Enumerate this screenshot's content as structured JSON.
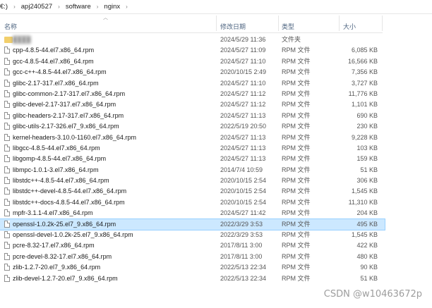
{
  "breadcrumb": {
    "items": [
      "€:)",
      "apj240527",
      "software",
      "nginx"
    ],
    "separator": "›"
  },
  "columns": {
    "name": "名称",
    "date": "修改日期",
    "type": "类型",
    "size": "大小"
  },
  "files": [
    {
      "name": "████",
      "date": "2024/5/29 11:36",
      "type": "文件夹",
      "size": "",
      "icon": "folder-icon",
      "blurred": true
    },
    {
      "name": "cpp-4.8.5-44.el7.x86_64.rpm",
      "date": "2024/5/27 11:09",
      "type": "RPM 文件",
      "size": "6,085 KB"
    },
    {
      "name": "gcc-4.8.5-44.el7.x86_64.rpm",
      "date": "2024/5/27 11:10",
      "type": "RPM 文件",
      "size": "16,566 KB"
    },
    {
      "name": "gcc-c++-4.8.5-44.el7.x86_64.rpm",
      "date": "2020/10/15 2:49",
      "type": "RPM 文件",
      "size": "7,356 KB"
    },
    {
      "name": "glibc-2.17-317.el7.x86_64.rpm",
      "date": "2024/5/27 11:10",
      "type": "RPM 文件",
      "size": "3,727 KB"
    },
    {
      "name": "glibc-common-2.17-317.el7.x86_64.rpm",
      "date": "2024/5/27 11:12",
      "type": "RPM 文件",
      "size": "11,776 KB"
    },
    {
      "name": "glibc-devel-2.17-317.el7.x86_64.rpm",
      "date": "2024/5/27 11:12",
      "type": "RPM 文件",
      "size": "1,101 KB"
    },
    {
      "name": "glibc-headers-2.17-317.el7.x86_64.rpm",
      "date": "2024/5/27 11:13",
      "type": "RPM 文件",
      "size": "690 KB"
    },
    {
      "name": "glibc-utils-2.17-326.el7_9.x86_64.rpm",
      "date": "2022/5/19 20:50",
      "type": "RPM 文件",
      "size": "230 KB"
    },
    {
      "name": "kernel-headers-3.10.0-1160.el7.x86_64.rpm",
      "date": "2024/5/27 11:13",
      "type": "RPM 文件",
      "size": "9,228 KB"
    },
    {
      "name": "libgcc-4.8.5-44.el7.x86_64.rpm",
      "date": "2024/5/27 11:13",
      "type": "RPM 文件",
      "size": "103 KB"
    },
    {
      "name": "libgomp-4.8.5-44.el7.x86_64.rpm",
      "date": "2024/5/27 11:13",
      "type": "RPM 文件",
      "size": "159 KB"
    },
    {
      "name": "libmpc-1.0.1-3.el7.x86_64.rpm",
      "date": "2014/7/4 10:59",
      "type": "RPM 文件",
      "size": "51 KB"
    },
    {
      "name": "libstdc++-4.8.5-44.el7.x86_64.rpm",
      "date": "2020/10/15 2:54",
      "type": "RPM 文件",
      "size": "306 KB"
    },
    {
      "name": "libstdc++-devel-4.8.5-44.el7.x86_64.rpm",
      "date": "2020/10/15 2:54",
      "type": "RPM 文件",
      "size": "1,545 KB"
    },
    {
      "name": "libstdc++-docs-4.8.5-44.el7.x86_64.rpm",
      "date": "2020/10/15 2:54",
      "type": "RPM 文件",
      "size": "11,310 KB"
    },
    {
      "name": "mpfr-3.1.1-4.el7.x86_64.rpm",
      "date": "2024/5/27 11:42",
      "type": "RPM 文件",
      "size": "204 KB"
    },
    {
      "name": "openssl-1.0.2k-25.el7_9.x86_64.rpm",
      "date": "2022/3/29 3:53",
      "type": "RPM 文件",
      "size": "495 KB",
      "selected": true
    },
    {
      "name": "openssl-devel-1.0.2k-25.el7_9.x86_64.rpm",
      "date": "2022/3/29 3:53",
      "type": "RPM 文件",
      "size": "1,545 KB"
    },
    {
      "name": "pcre-8.32-17.el7.x86_64.rpm",
      "date": "2017/8/11 3:00",
      "type": "RPM 文件",
      "size": "422 KB"
    },
    {
      "name": "pcre-devel-8.32-17.el7.x86_64.rpm",
      "date": "2017/8/11 3:00",
      "type": "RPM 文件",
      "size": "480 KB"
    },
    {
      "name": "zlib-1.2.7-20.el7_9.x86_64.rpm",
      "date": "2022/5/13 22:34",
      "type": "RPM 文件",
      "size": "90 KB"
    },
    {
      "name": "zlib-devel-1.2.7-20.el7_9.x86_64.rpm",
      "date": "2022/5/13 22:34",
      "type": "RPM 文件",
      "size": "51 KB"
    }
  ],
  "watermark": "CSDN @w10463672p",
  "colors": {
    "selection": "#cce8ff",
    "header_text": "#4d6480"
  }
}
